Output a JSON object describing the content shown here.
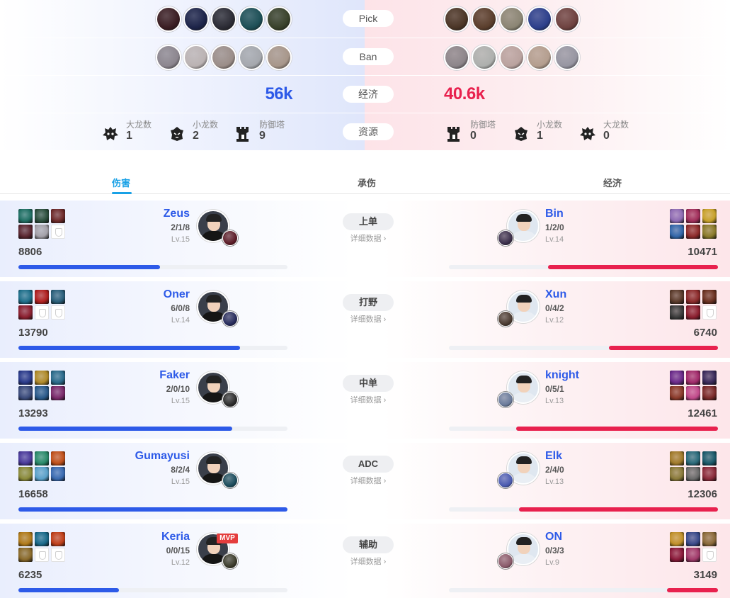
{
  "summary": {
    "labels": {
      "pick": "Pick",
      "ban": "Ban",
      "gold": "经济",
      "resources": "资源"
    },
    "blue": {
      "picks": [
        "#3a1d22",
        "#1c2348",
        "#2b2b34",
        "#1d4f56",
        "#39412a"
      ],
      "bans": [
        "#8a7d8f",
        "#b9a8a8",
        "#a08479",
        "#9aa0ab",
        "#b08c72"
      ],
      "gold": "56k",
      "resources": [
        {
          "icon": "baron-icon",
          "label": "大龙数",
          "value": "1"
        },
        {
          "icon": "dragon-icon",
          "label": "小龙数",
          "value": "2"
        },
        {
          "icon": "tower-icon",
          "label": "防御塔",
          "value": "9"
        }
      ]
    },
    "red": {
      "picks": [
        "#4a3526",
        "#5a3e2c",
        "#8b8574",
        "#2c3f8b",
        "#6e4240"
      ],
      "bans": [
        "#8b7d86",
        "#a3a8a3",
        "#c6958d",
        "#c09272",
        "#8f8da6"
      ],
      "gold": "40.6k",
      "resources": [
        {
          "icon": "tower-icon",
          "label": "防御塔",
          "value": "0"
        },
        {
          "icon": "dragon-icon",
          "label": "小龙数",
          "value": "1"
        },
        {
          "icon": "baron-icon",
          "label": "大龙数",
          "value": "0"
        }
      ]
    }
  },
  "tabs": [
    {
      "label": "伤害",
      "active": true
    },
    {
      "label": "承伤",
      "active": false
    },
    {
      "label": "经济",
      "active": false
    }
  ],
  "detail_label": "详细数据 ›",
  "mvp_label": "MVP",
  "rows": [
    {
      "role": "上单",
      "blue": {
        "name": "Zeus",
        "kda": "2/1/8",
        "level": "Lv.15",
        "score": "8806",
        "fraction": 0.526,
        "items": [
          "#1f6f63",
          "#2c4e3d",
          "#6e2a2a",
          "#5a2630",
          "#a3a0a8",
          null
        ],
        "champ": "#5b1b26",
        "shirt": "#151515"
      },
      "red": {
        "name": "Bin",
        "kda": "1/2/0",
        "level": "Lv.14",
        "score": "10471",
        "fraction": 0.632,
        "items": [
          "#8e6bb3",
          "#a02e5a",
          "#c7a12a",
          "#3266a8",
          "#8c2a2a",
          "#8a7a2a"
        ],
        "champ": "#3a2e4a",
        "shirt": "#e9eef4"
      }
    },
    {
      "role": "打野",
      "blue": {
        "name": "Oner",
        "kda": "6/0/8",
        "level": "Lv.14",
        "score": "13790",
        "fraction": 0.824,
        "items": [
          "#1f6f8a",
          "#b02020",
          "#2a5f7a",
          "#8a1e2e",
          null,
          null
        ],
        "champ": "#262a5a",
        "shirt": "#151515"
      },
      "red": {
        "name": "Xun",
        "kda": "0/4/2",
        "level": "Lv.12",
        "score": "6740",
        "fraction": 0.405,
        "items": [
          "#5a3a2a",
          "#8a2a2a",
          "#6a3020",
          "#3a3a3a",
          "#8a1e2e",
          null
        ],
        "champ": "#4a3a30",
        "shirt": "#e9eef4"
      }
    },
    {
      "role": "中单",
      "blue": {
        "name": "Faker",
        "kda": "2/0/10",
        "level": "Lv.15",
        "score": "13293",
        "fraction": 0.794,
        "items": [
          "#2a3a8a",
          "#b08a2a",
          "#2a6a8a",
          "#3a4a7a",
          "#2a5a8a",
          "#7a2a6a"
        ],
        "champ": "#2a2a2a",
        "shirt": "#151515"
      },
      "red": {
        "name": "knight",
        "kda": "0/5/1",
        "level": "Lv.13",
        "score": "12461",
        "fraction": 0.75,
        "items": [
          "#6a2a8a",
          "#a02a6a",
          "#3a2a5a",
          "#8a3a2a",
          "#c04a8a",
          "#7a2a2a"
        ],
        "champ": "#6a7a9a",
        "shirt": "#e9eef4"
      }
    },
    {
      "role": "ADC",
      "blue": {
        "name": "Gumayusi",
        "kda": "8/2/4",
        "level": "Lv.15",
        "score": "16658",
        "fraction": 1.0,
        "items": [
          "#4a3a9a",
          "#2a8a6a",
          "#c0501a",
          "#8a8a3a",
          "#5aa0c8",
          "#3a6ab0"
        ],
        "champ": "#1a4a5a",
        "shirt": "#151515"
      },
      "red": {
        "name": "Elk",
        "kda": "2/4/0",
        "level": "Lv.13",
        "score": "12306",
        "fraction": 0.74,
        "items": [
          "#a07a2a",
          "#2a6a7a",
          "#1a5a6a",
          "#8a7a3a",
          "#6a6a6a",
          "#8a2a3a"
        ],
        "champ": "#4a5ab0",
        "shirt": "#e9eef4"
      }
    },
    {
      "role": "辅助",
      "blue": {
        "name": "Keria",
        "kda": "0/0/15",
        "level": "Lv.12",
        "score": "6235",
        "fraction": 0.374,
        "items": [
          "#b07a1a",
          "#1a6a8a",
          "#c0401a",
          "#8a6a2a",
          null,
          null
        ],
        "champ": "#3a3a2a",
        "shirt": "#151515",
        "mvp": true
      },
      "red": {
        "name": "ON",
        "kda": "0/3/3",
        "level": "Lv.9",
        "score": "3149",
        "fraction": 0.19,
        "items": [
          "#c0902a",
          "#3a4a8a",
          "#8a6a3a",
          "#8a1a3a",
          "#a03a6a",
          null
        ],
        "champ": "#8a5a6a",
        "shirt": "#e9eef4"
      }
    }
  ]
}
